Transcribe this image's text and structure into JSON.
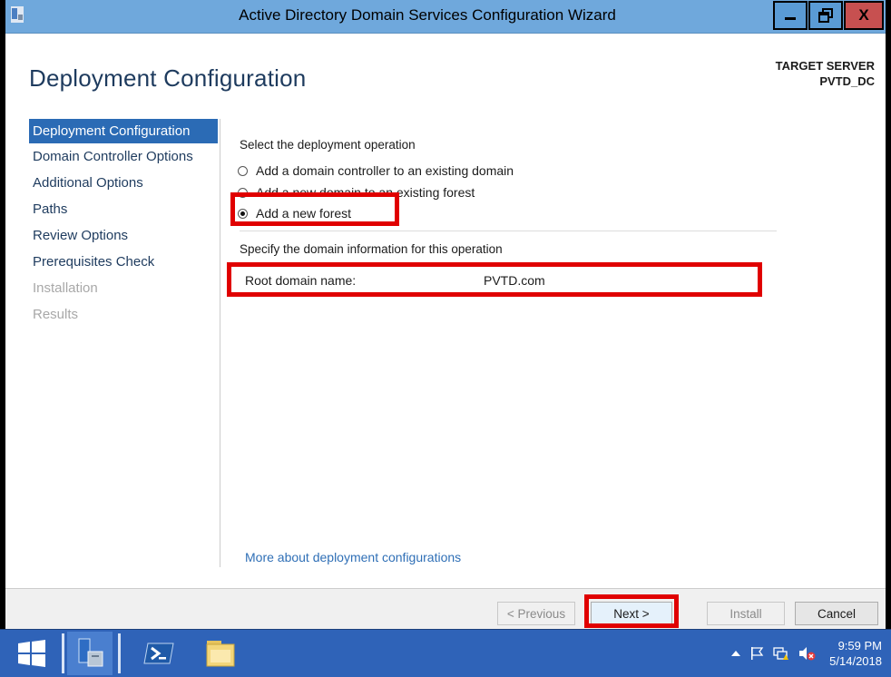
{
  "window": {
    "title": "Active Directory Domain Services Configuration Wizard",
    "minimize_label": "—",
    "maximize_label": "▣",
    "close_label": "X"
  },
  "header": {
    "page_title": "Deployment Configuration",
    "target_label": "TARGET SERVER",
    "target_value": "PVTD_DC"
  },
  "nav": {
    "items": [
      {
        "label": "Deployment Configuration",
        "state": "active"
      },
      {
        "label": "Domain Controller Options",
        "state": "enabled"
      },
      {
        "label": "Additional Options",
        "state": "enabled"
      },
      {
        "label": "Paths",
        "state": "enabled"
      },
      {
        "label": "Review Options",
        "state": "enabled"
      },
      {
        "label": "Prerequisites Check",
        "state": "enabled"
      },
      {
        "label": "Installation",
        "state": "disabled"
      },
      {
        "label": "Results",
        "state": "disabled"
      }
    ]
  },
  "main": {
    "operation_label": "Select the deployment operation",
    "options": [
      {
        "label": "Add a domain controller to an existing domain",
        "checked": false
      },
      {
        "label": "Add a new domain to an existing forest",
        "checked": false
      },
      {
        "label": "Add a new forest",
        "checked": true
      }
    ],
    "domain_info_label": "Specify the domain information for this operation",
    "root_domain_label": "Root domain name:",
    "root_domain_value": "PVTD.com",
    "more_link": "More about deployment configurations"
  },
  "footer": {
    "previous_label": "< Previous",
    "next_label": "Next >",
    "install_label": "Install",
    "cancel_label": "Cancel"
  },
  "taskbar": {
    "time": "9:59 PM",
    "date": "5/14/2018"
  },
  "colors": {
    "highlight": "#e00000",
    "nav_active": "#2b6bb5",
    "title_text": "#1e3b5e",
    "link": "#2f6fb6",
    "taskbar": "#2f63b8"
  }
}
